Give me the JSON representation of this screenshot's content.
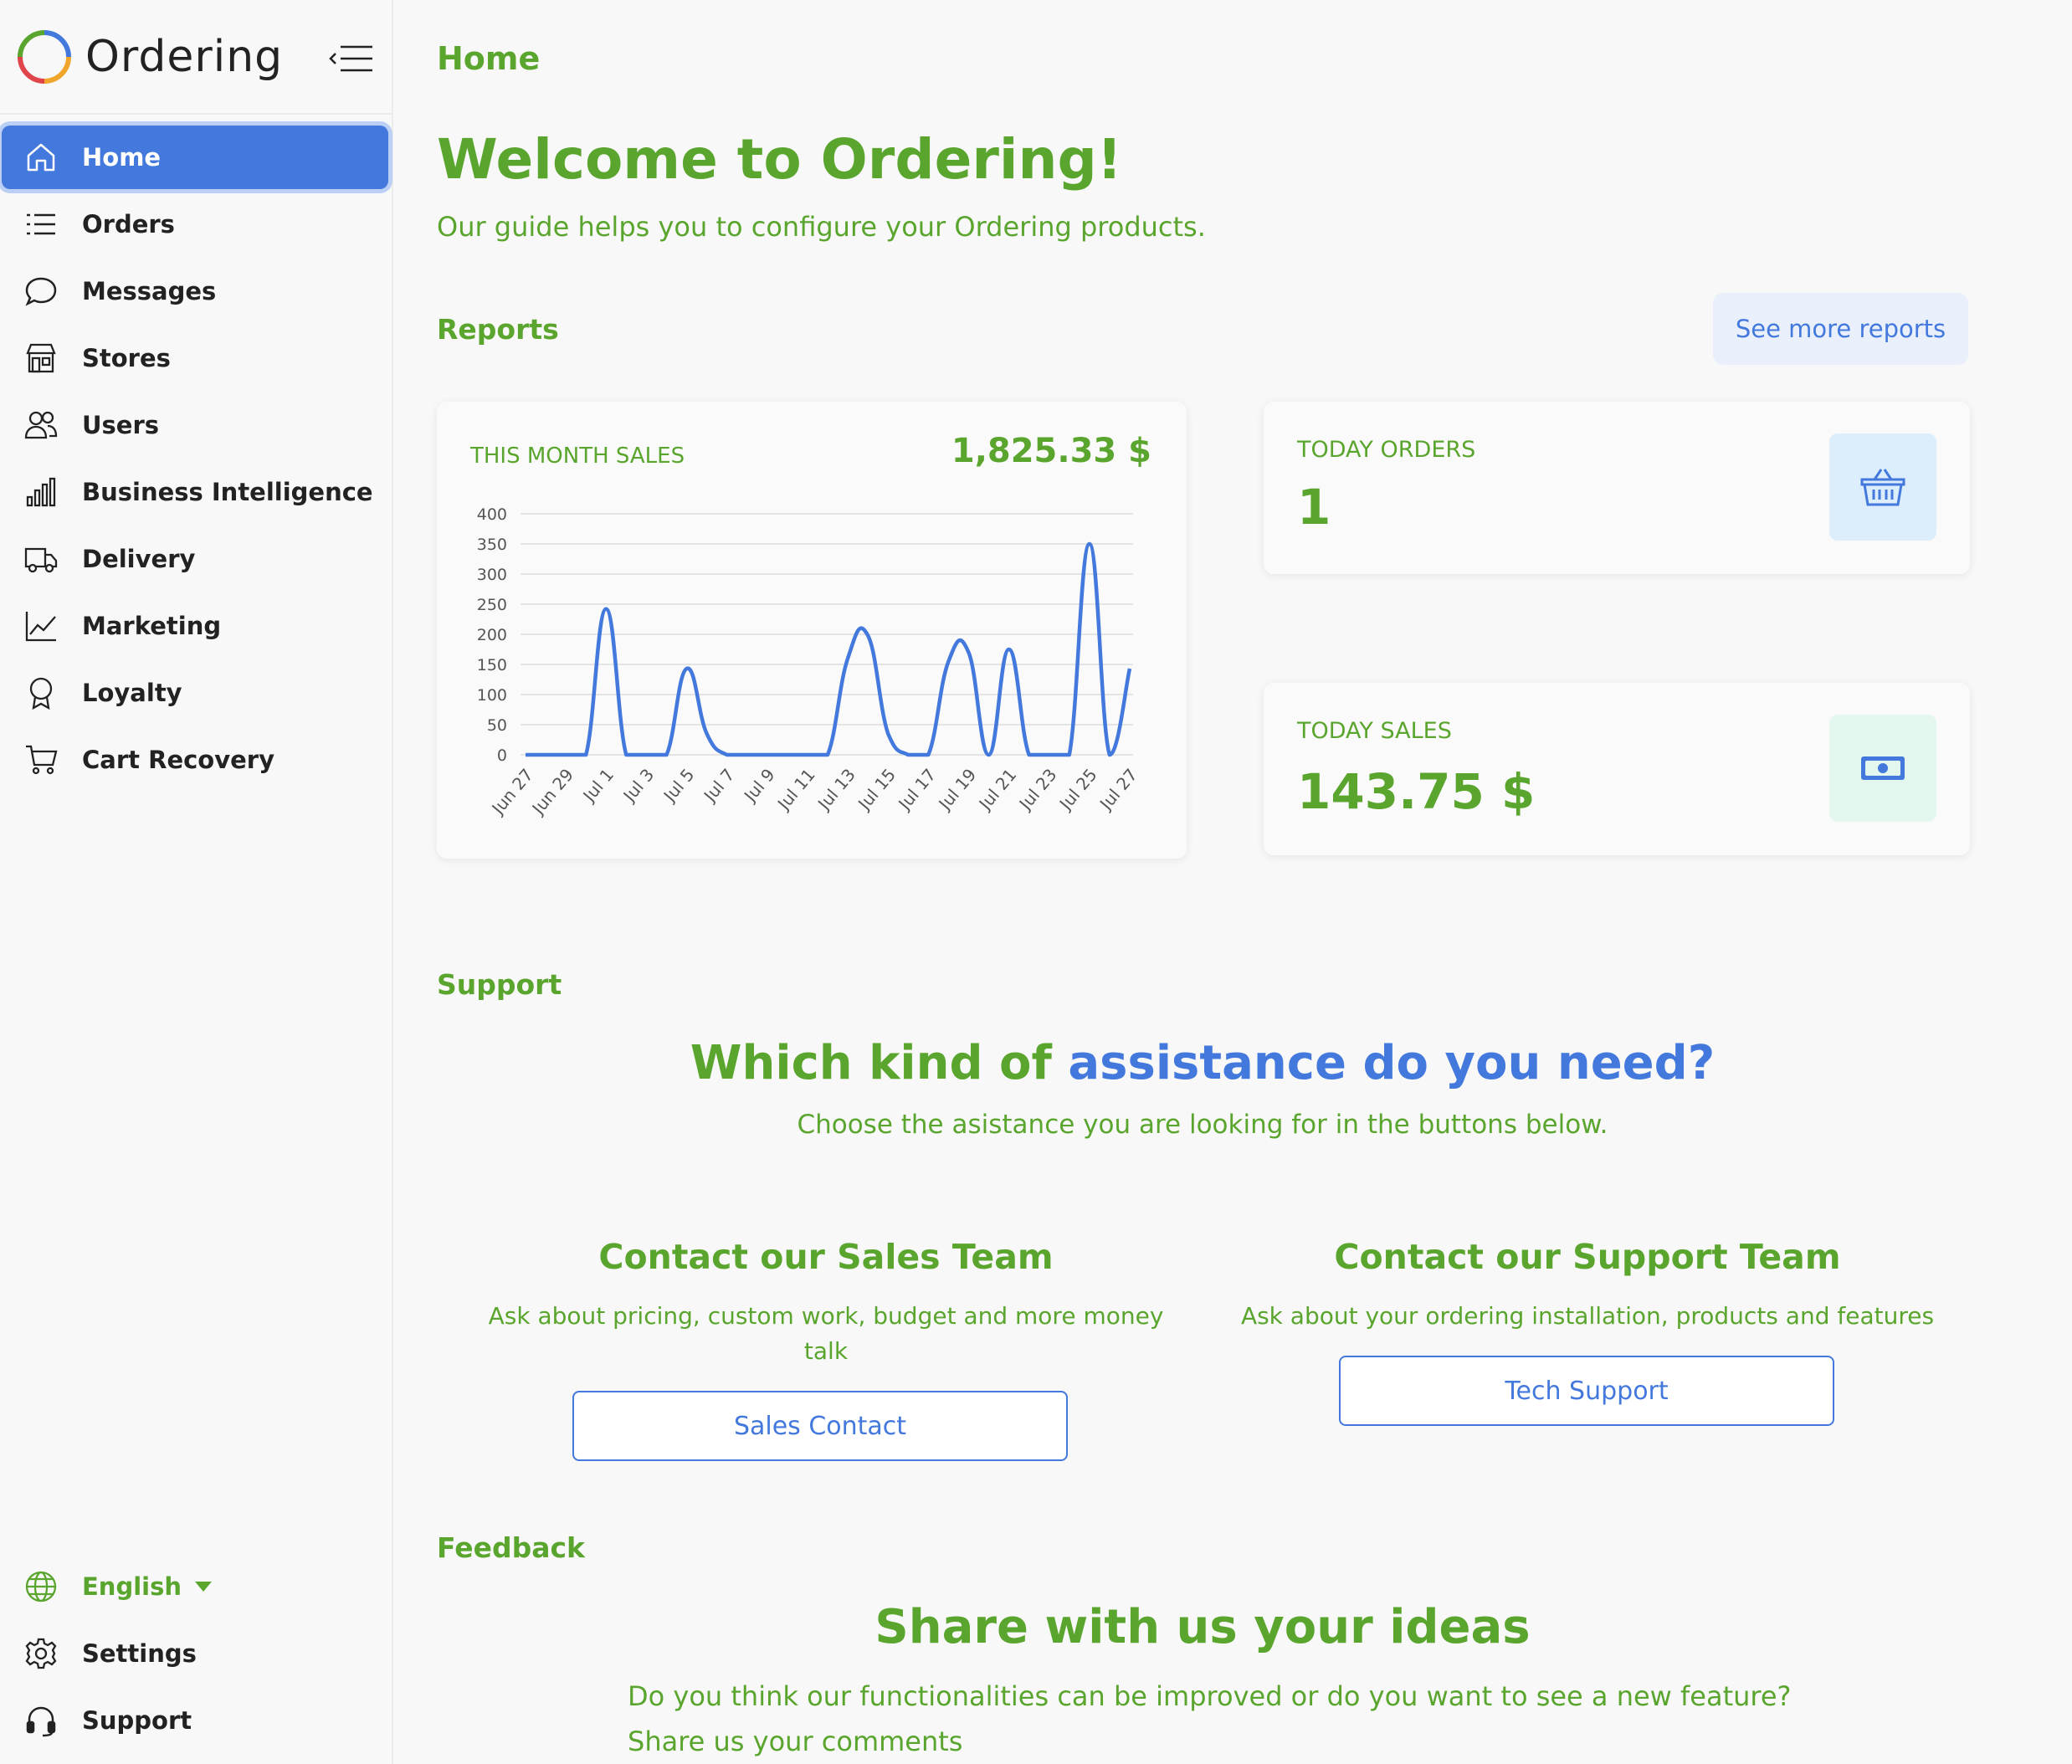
{
  "brand": {
    "name": "Ordering"
  },
  "sidebar": {
    "items": [
      {
        "label": "Home",
        "icon": "home-icon"
      },
      {
        "label": "Orders",
        "icon": "list-icon"
      },
      {
        "label": "Messages",
        "icon": "chat-icon"
      },
      {
        "label": "Stores",
        "icon": "store-icon"
      },
      {
        "label": "Users",
        "icon": "users-icon"
      },
      {
        "label": "Business Intelligence",
        "icon": "bar-chart-icon"
      },
      {
        "label": "Delivery",
        "icon": "truck-icon"
      },
      {
        "label": "Marketing",
        "icon": "line-chart-icon"
      },
      {
        "label": "Loyalty",
        "icon": "award-icon"
      },
      {
        "label": "Cart Recovery",
        "icon": "cart-icon"
      }
    ],
    "active": "Home",
    "language": "English",
    "settings": "Settings",
    "support": "Support"
  },
  "page": {
    "title": "Home",
    "welcome": "Welcome to Ordering!",
    "welcome_sub": "Our guide helps you to configure your Ordering products."
  },
  "reports": {
    "label": "Reports",
    "see_more": "See more reports",
    "month_sales_label": "THIS MONTH SALES",
    "month_sales_value": "1,825.33 $",
    "today_orders_label": "TODAY ORDERS",
    "today_orders_value": "1",
    "today_sales_label": "TODAY SALES",
    "today_sales_value": "143.75 $"
  },
  "chart_data": {
    "type": "line",
    "title": "",
    "xlabel": "",
    "ylabel": "",
    "ylim": [
      0,
      400
    ],
    "yticks": [
      0,
      50,
      100,
      150,
      200,
      250,
      300,
      350,
      400
    ],
    "x_tick_labels": [
      "Jun 27",
      "Jun 29",
      "Jul 1",
      "Jul 3",
      "Jul 5",
      "Jul 7",
      "Jul 9",
      "Jul 11",
      "Jul 13",
      "Jul 15",
      "Jul 17",
      "Jul 19",
      "Jul 21",
      "Jul 23",
      "Jul 25",
      "Jul 27"
    ],
    "x": [
      "Jun 27",
      "Jun 28",
      "Jun 29",
      "Jun 30",
      "Jul 1",
      "Jul 2",
      "Jul 3",
      "Jul 4",
      "Jul 5",
      "Jul 6",
      "Jul 7",
      "Jul 8",
      "Jul 9",
      "Jul 10",
      "Jul 11",
      "Jul 12",
      "Jul 13",
      "Jul 14",
      "Jul 15",
      "Jul 16",
      "Jul 17",
      "Jul 18",
      "Jul 19",
      "Jul 20",
      "Jul 21",
      "Jul 22",
      "Jul 23",
      "Jul 24",
      "Jul 25",
      "Jul 26",
      "Jul 27"
    ],
    "values": [
      0,
      0,
      0,
      0,
      242,
      0,
      0,
      0,
      143,
      35,
      0,
      0,
      0,
      0,
      0,
      0,
      160,
      198,
      35,
      0,
      0,
      155,
      170,
      0,
      175,
      0,
      0,
      0,
      350,
      0,
      143
    ],
    "color": "#4378dd",
    "grid": true
  },
  "support": {
    "label": "Support",
    "title_part1": "Which kind of ",
    "title_part2": "assistance do you need?",
    "subtitle": "Choose the asistance you are looking for in the buttons below.",
    "sales_title": "Contact our Sales Team",
    "sales_desc": "Ask about pricing, custom work, budget and more money talk",
    "sales_btn": "Sales Contact",
    "tech_title": "Contact our Support Team",
    "tech_desc": "Ask about your ordering installation, products and features",
    "tech_btn": "Tech Support"
  },
  "feedback": {
    "label": "Feedback",
    "title": "Share with us your ideas",
    "line1": "Do you think our functionalities can be improved or do you want to see a new feature?",
    "line2": "Share us your comments"
  },
  "colors": {
    "green": "#5aa52d",
    "blue": "#4378dd",
    "active_bg": "#4378dd"
  }
}
